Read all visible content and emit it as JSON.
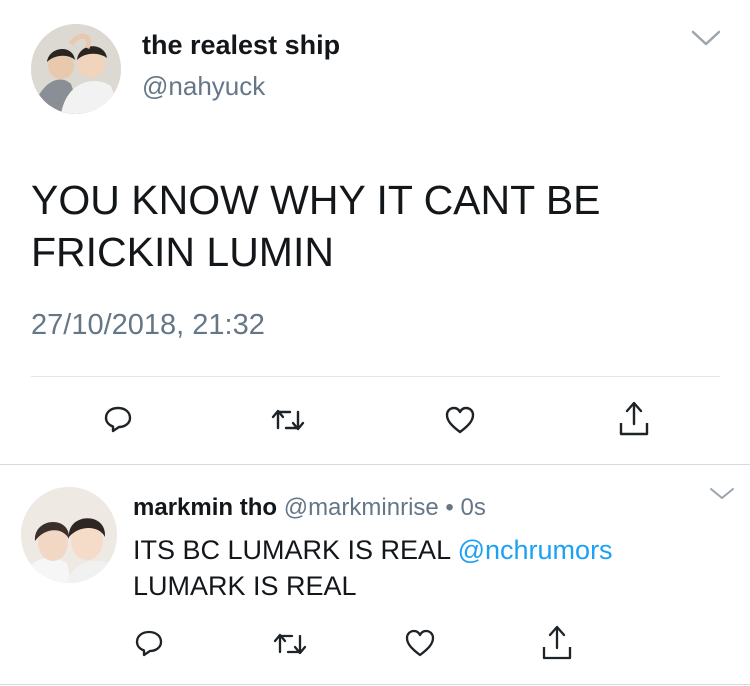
{
  "tweet": {
    "display_name": "the realest ship",
    "handle": "@nahyuck",
    "text_line1": "YOU KNOW WHY IT CANT BE",
    "text_line2": "FRICKIN LUMIN",
    "timestamp": "27/10/2018, 21:32"
  },
  "reply": {
    "display_name": "markmin tho",
    "handle": "@markminrise",
    "separator": "•",
    "time": "0s",
    "text_before_mention": "ITS BC LUMARK IS REAL",
    "mention": "@nchrumors",
    "text_line2": "LUMARK IS REAL"
  },
  "icons": [
    "chevron-down-icon",
    "reply-icon",
    "retweet-icon",
    "like-icon",
    "share-icon"
  ],
  "colors": {
    "text": "#14171a",
    "muted": "#657786",
    "link": "#1da1f2",
    "divider": "#e1e8ed"
  }
}
